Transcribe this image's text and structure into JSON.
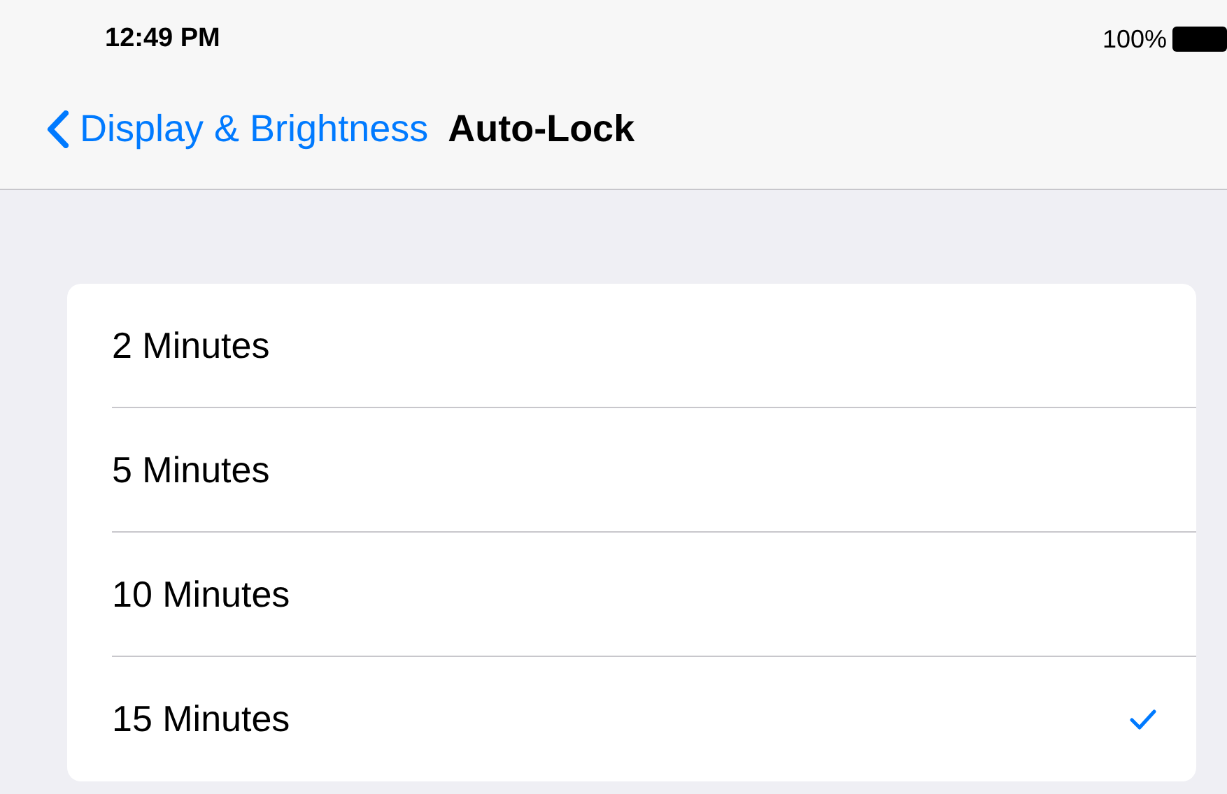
{
  "status_bar": {
    "time": "12:49 PM",
    "battery": "100%"
  },
  "nav": {
    "back": "Display & Brightness",
    "title": "Auto-Lock"
  },
  "options": [
    {
      "label": "2 Minutes",
      "selected": false
    },
    {
      "label": "5 Minutes",
      "selected": false
    },
    {
      "label": "10 Minutes",
      "selected": false
    },
    {
      "label": "15 Minutes",
      "selected": true
    }
  ]
}
